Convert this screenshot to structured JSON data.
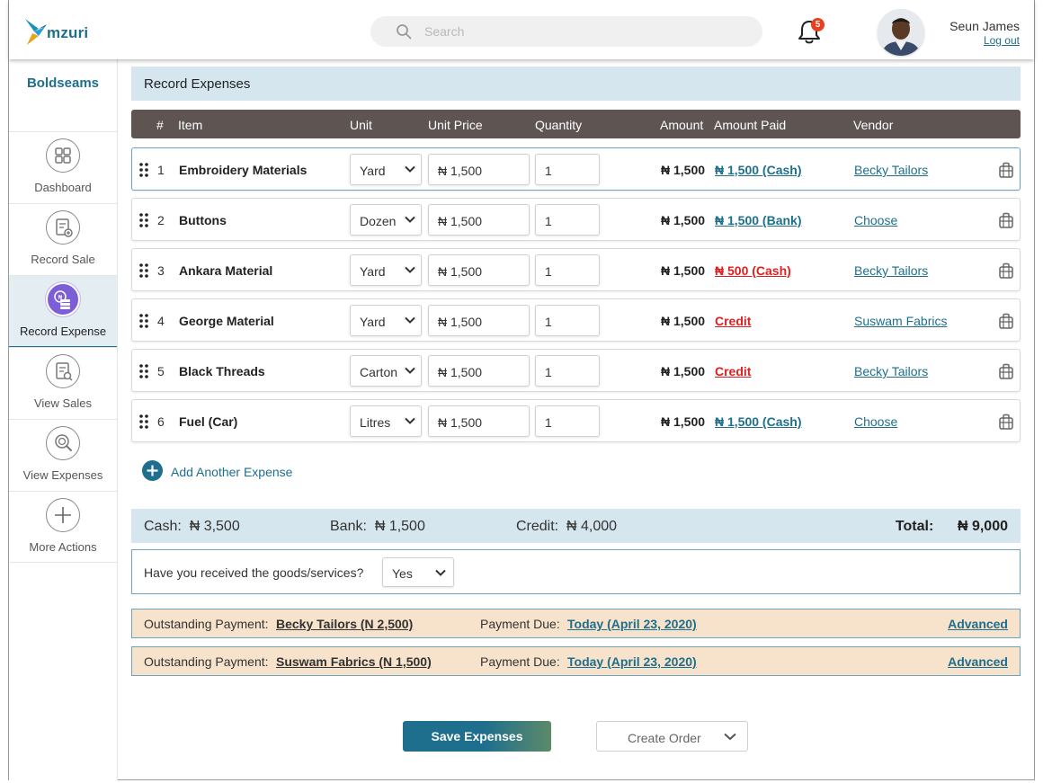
{
  "app": {
    "brand": "mzuri"
  },
  "header": {
    "search_placeholder": "Search",
    "notification_count": "5",
    "user_name": "Seun James",
    "logout_label": "Log out"
  },
  "sidebar": {
    "business_name": "Boldseams",
    "items": [
      {
        "label": "Dashboard",
        "icon": "dashboard-icon"
      },
      {
        "label": "Record Sale",
        "icon": "record-sale-icon"
      },
      {
        "label": "Record Expense",
        "icon": "record-expense-icon",
        "active": true
      },
      {
        "label": "View Sales",
        "icon": "view-sales-icon"
      },
      {
        "label": "View Expenses",
        "icon": "view-expenses-icon"
      },
      {
        "label": "More Actions",
        "icon": "plus-icon"
      }
    ]
  },
  "main": {
    "title": "Record Expenses",
    "columns": {
      "num": "#",
      "item": "Item",
      "unit": "Unit",
      "unit_price": "Unit Price",
      "quantity": "Quantity",
      "amount": "Amount",
      "amount_paid": "Amount Paid",
      "vendor": "Vendor"
    },
    "rows": [
      {
        "num": "1",
        "item": "Embroidery Materials",
        "unit": "Yard",
        "unit_price": "₦ 1,500",
        "quantity": "1",
        "amount": "₦ 1,500",
        "amount_paid": "₦ 1,500 (Cash)",
        "paid_status": "blue",
        "vendor": "Becky Tailors"
      },
      {
        "num": "2",
        "item": "Buttons",
        "unit": "Dozen",
        "unit_price": "₦ 1,500",
        "quantity": "1",
        "amount": "₦ 1,500",
        "amount_paid": "₦ 1,500 (Bank)",
        "paid_status": "blue",
        "vendor": "Choose"
      },
      {
        "num": "3",
        "item": "Ankara Material",
        "unit": "Yard",
        "unit_price": "₦ 1,500",
        "quantity": "1",
        "amount": "₦ 1,500",
        "amount_paid": "₦ 500 (Cash)",
        "paid_status": "red",
        "vendor": "Becky Tailors"
      },
      {
        "num": "4",
        "item": "George Material",
        "unit": "Yard",
        "unit_price": "₦ 1,500",
        "quantity": "1",
        "amount": "₦ 1,500",
        "amount_paid": "Credit",
        "paid_status": "red",
        "vendor": "Suswam Fabrics"
      },
      {
        "num": "5",
        "item": "Black Threads",
        "unit": "Carton",
        "unit_price": "₦ 1,500",
        "quantity": "1",
        "amount": "₦ 1,500",
        "amount_paid": "Credit",
        "paid_status": "red",
        "vendor": "Becky Tailors"
      },
      {
        "num": "6",
        "item": "Fuel (Car)",
        "unit": "Litres",
        "unit_price": "₦ 1,500",
        "quantity": "1",
        "amount": "₦ 1,500",
        "amount_paid": "₦ 1,500 (Cash)",
        "paid_status": "blue",
        "vendor": "Choose"
      }
    ],
    "add_label": "Add Another Expense",
    "summary": {
      "cash_label": "Cash:",
      "cash_value": "₦ 3,500",
      "bank_label": "Bank:",
      "bank_value": "₦ 1,500",
      "credit_label": "Credit:",
      "credit_value": "₦ 4,000",
      "total_label": "Total:",
      "total_value": "₦ 9,000"
    },
    "goods_question": "Have you received the goods/services?",
    "goods_answer": "Yes",
    "outstanding": [
      {
        "label": "Outstanding Payment:",
        "vendor": "Becky Tailors (N 2,500)",
        "due_label": "Payment Due:",
        "due": "Today (April 23, 2020)",
        "advanced": "Advanced"
      },
      {
        "label": "Outstanding Payment:",
        "vendor": "Suswam Fabrics (N 1,500)",
        "due_label": "Payment Due:",
        "due": "Today (April 23, 2020)",
        "advanced": "Advanced"
      }
    ],
    "save_label": "Save Expenses",
    "order_label": "Create Order"
  },
  "colors": {
    "brand": "#1e6f8e",
    "header_row": "#5e5553",
    "panel": "#d5e6ee",
    "outstanding_bg": "#f7e3cb",
    "red": "#e02020",
    "active_icon": "#7c5fd6"
  }
}
